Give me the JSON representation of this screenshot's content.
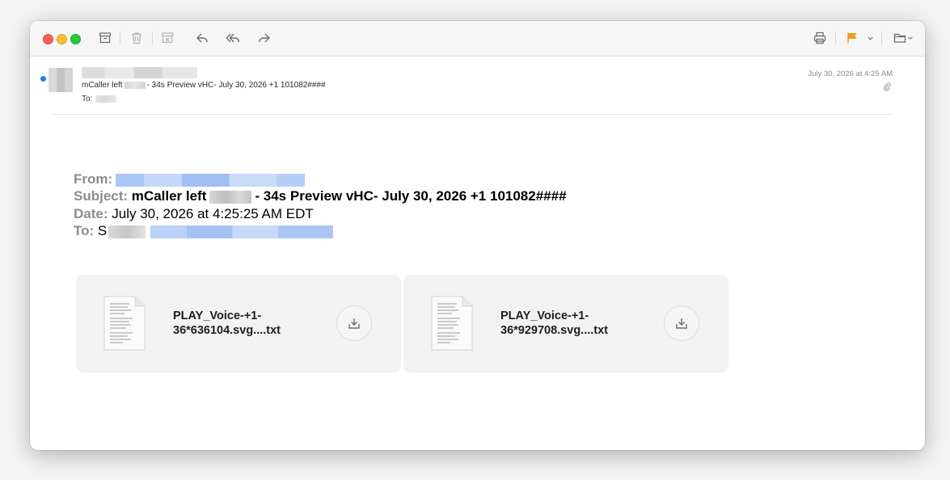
{
  "toolbar": {
    "icons": [
      "archive-icon",
      "trash-icon",
      "junk-icon",
      "reply-icon",
      "reply-all-icon",
      "forward-icon",
      "print-icon",
      "flag-icon",
      "chevron-down-icon",
      "folder-icon"
    ],
    "flag_color": "#f39c12"
  },
  "header": {
    "subject_prefix": "mCaller left",
    "subject_suffix": "- 34s  Preview vHC- July 30, 2026 +1 101082####",
    "to_label": "To:",
    "date": "July 30, 2026 at 4:25 AM",
    "unread_color": "#1f7ef5"
  },
  "forwarded": {
    "from_label": "From:",
    "subject_label": "Subject:",
    "subject_prefix": "mCaller left",
    "subject_suffix": "- 34s Preview vHC- July 30, 2026 +1 101082####",
    "date_label": "Date:",
    "date_value": "July 30, 2026 at 4:25:25 AM EDT",
    "to_label": "To:",
    "to_initial": "S"
  },
  "attachments": [
    {
      "line1": "PLAY_Voice-+1-",
      "line2": "36*636104.svg....txt"
    },
    {
      "line1": "PLAY_Voice-+1-",
      "line2": "36*929708.svg....txt"
    }
  ]
}
